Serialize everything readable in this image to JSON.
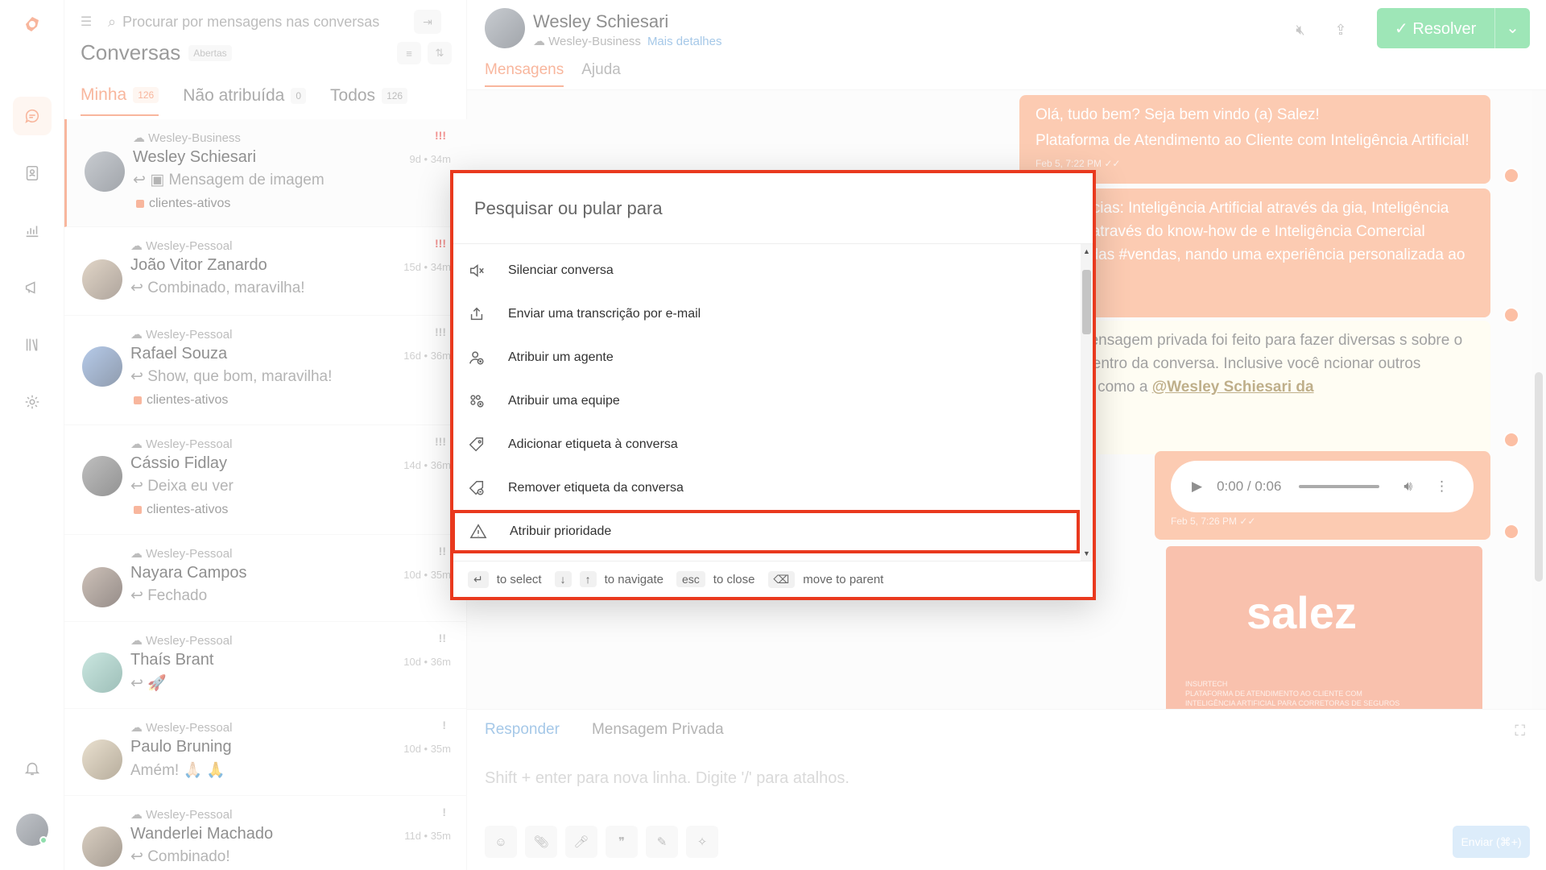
{
  "list": {
    "search_placeholder": "Procurar por mensagens nas conversas",
    "title": "Conversas",
    "status_badge": "Abertas",
    "tabs": [
      {
        "label": "Minha",
        "count": "126"
      },
      {
        "label": "Não atribuída",
        "count": "0"
      },
      {
        "label": "Todos",
        "count": "126"
      }
    ],
    "conversations": [
      {
        "inbox": "Wesley-Business",
        "name": "Wesley Schiesari",
        "message": "Mensagem de imagem",
        "time": "9d • 34m",
        "priority": "!!!",
        "label": "clientes-ativos"
      },
      {
        "inbox": "Wesley-Pessoal",
        "name": "João Vitor Zanardo",
        "message": "Combinado, maravilha!",
        "time": "15d • 34m",
        "priority": "!!!",
        "label": ""
      },
      {
        "inbox": "Wesley-Pessoal",
        "name": "Rafael Souza",
        "message": "Show, que bom, maravilha!",
        "time": "16d • 36m",
        "priority": "!!!",
        "label": "clientes-ativos"
      },
      {
        "inbox": "Wesley-Pessoal",
        "name": "Cássio Fidlay",
        "message": "Deixa eu ver",
        "time": "14d • 36m",
        "priority": "!!!",
        "label": "clientes-ativos"
      },
      {
        "inbox": "Wesley-Pessoal",
        "name": "Nayara Campos",
        "message": "Fechado",
        "time": "10d • 35m",
        "priority": "!!",
        "label": ""
      },
      {
        "inbox": "Wesley-Pessoal",
        "name": "Thaís Brant",
        "message": "🚀",
        "time": "10d • 36m",
        "priority": "!!",
        "label": ""
      },
      {
        "inbox": "Wesley-Pessoal",
        "name": "Paulo Bruning",
        "message": "Amém! 🙏🏻 🙏",
        "time": "10d • 35m",
        "priority": "!",
        "label": ""
      },
      {
        "inbox": "Wesley-Pessoal",
        "name": "Wanderlei Machado",
        "message": "Combinado!",
        "time": "11d • 35m",
        "priority": "!",
        "label": ""
      }
    ]
  },
  "chat": {
    "contact_name": "Wesley Schiesari",
    "inbox": "Wesley-Business",
    "more_details": "Mais detalhes",
    "resolve_label": "Resolver",
    "tabs": [
      "Mensagens",
      "Ajuda"
    ],
    "messages": {
      "m1_line1": "Olá, tudo bem? Seja bem vindo (a) Salez!",
      "m1_line2": "Plataforma de Atendimento ao Cliente com Inteligência Artificial!",
      "m1_meta": "Feb 5, 7:22 PM",
      "m2_text": "inteligências: Inteligência Artificial através da gia, Inteligência Setorial através do know-how de e Inteligência Comercial através das #vendas, nando uma experiência personalizada ao cliente.",
      "m3_text": "ço de mensagem privada foi feito para fazer diversas s sobre o cliente dentro da conversa. Inclusive você ncionar outros usuários como a",
      "m3_mention": "@Wesley Schiesari da",
      "audio_time": "0:00 / 0:06",
      "audio_meta": "Feb 5, 7:26 PM",
      "image_brand": "salez",
      "image_tagline": "INSURTECH\nPLATAFORMA DE ATENDIMENTO AO CLIENTE COM\nINTELIGÊNCIA ARTIFICIAL PARA CORRETORAS DE SEGUROS"
    },
    "composer": {
      "tab_reply": "Responder",
      "tab_private": "Mensagem Privada",
      "placeholder": "Shift + enter para nova linha. Digite '/' para atalhos.",
      "send_label": "Enviar (⌘+)"
    }
  },
  "palette": {
    "placeholder": "Pesquisar ou pular para",
    "items": [
      {
        "label": "Silenciar conversa",
        "icon": "mute-icon"
      },
      {
        "label": "Enviar uma transcrição por e-mail",
        "icon": "share-icon"
      },
      {
        "label": "Atribuir um agente",
        "icon": "person-add-icon"
      },
      {
        "label": "Atribuir uma equipe",
        "icon": "team-icon"
      },
      {
        "label": "Adicionar etiqueta à conversa",
        "icon": "tag-icon"
      },
      {
        "label": "Remover etiqueta da conversa",
        "icon": "tag-remove-icon"
      },
      {
        "label": "Atribuir prioridade",
        "icon": "warning-icon"
      }
    ],
    "footer": {
      "enter_hint": "to select",
      "nav_hint": "to navigate",
      "esc_key": "esc",
      "esc_hint": "to close",
      "back_hint": "move to parent"
    }
  },
  "colors": {
    "accent": "#f37b4d",
    "highlight": "#e9391e",
    "resolve": "#4fd27d",
    "outgoing": "#f9a074",
    "private": "#fffbea"
  }
}
